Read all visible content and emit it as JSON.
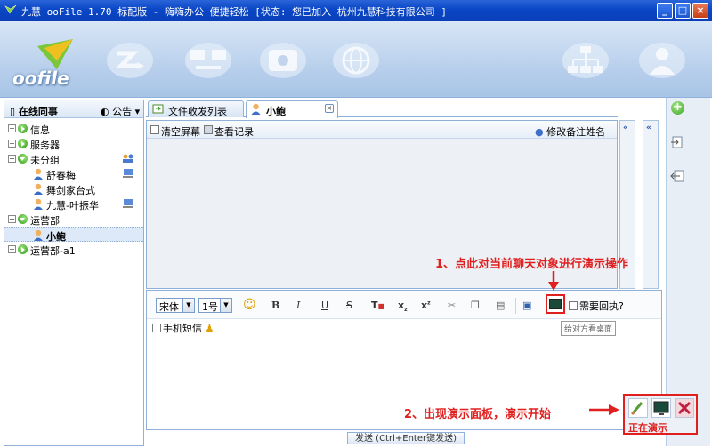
{
  "window": {
    "title": "九慧 ooFile 1.70 标配版 - 嗨嗨办公 便捷轻松 [状态: 您已加入 杭州九慧科技有限公司 ]",
    "minimize": "_",
    "maximize": "□",
    "close": "×"
  },
  "banner": {
    "logo_text": "oofile",
    "tools": [
      "message-icon",
      "network-icon",
      "disk-icon",
      "globe-icon",
      "org-chart-icon",
      "user-icon"
    ]
  },
  "left_panel": {
    "online_label": "在线同事",
    "notice_label": "公告",
    "tree": [
      {
        "label": "信息",
        "type": "group",
        "expanded": false
      },
      {
        "label": "服务器",
        "type": "group",
        "expanded": false
      },
      {
        "label": "未分组",
        "type": "group",
        "expanded": true
      },
      {
        "label": "舒春梅",
        "type": "member"
      },
      {
        "label": "舞剑家台式",
        "type": "member"
      },
      {
        "label": "九慧-叶振华",
        "type": "member"
      },
      {
        "label": "运营部",
        "type": "group",
        "expanded": true
      },
      {
        "label": "小鲍",
        "type": "member",
        "selected": true
      },
      {
        "label": "运营部-a1",
        "type": "group",
        "expanded": false
      }
    ]
  },
  "tabs": {
    "file_list": "文件收发列表",
    "chat_user": "小鲍",
    "close": "×"
  },
  "chat": {
    "clear_screen": "清空屏幕",
    "view_history": "查看记录",
    "edit_remark": "修改备注姓名",
    "collapse": "«"
  },
  "input": {
    "font": "宋体",
    "size": "1号",
    "bold": "B",
    "italic": "I",
    "underline": "U",
    "strike": "S",
    "subscript": "x",
    "superscript": "x",
    "need_reply": "需要回执?",
    "tooltip": "给对方看桌面",
    "sms": "手机短信",
    "send": "发送 (Ctrl+Enter键发送)"
  },
  "annotations": {
    "step1": "1、点此对当前聊天对象进行演示操作",
    "step2": "2、出现演示面板，演示开始",
    "demo_status": "正在演示"
  },
  "colors": {
    "titlebar": "#0a46c6",
    "accent": "#8fb0d8",
    "annotation": "#e0201f",
    "online_dot": "#2e9a18"
  }
}
